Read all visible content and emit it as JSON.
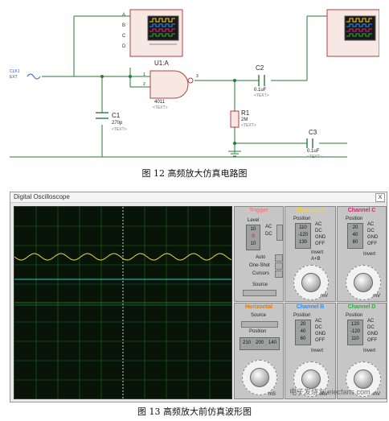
{
  "schematic": {
    "gate_label": "U1:A",
    "gate_part": "4011",
    "text_tag": "<TEXT>",
    "c1_name": "C1",
    "c1_value": "270p",
    "c2_name": "C2",
    "c2_value": "0.1uF",
    "c3_name": "C3",
    "c3_value": "0.1uF",
    "r1_name": "R1",
    "r1_value": "2M",
    "source_label": "CLK1",
    "source_sub": "EXT",
    "gate_in_a": "1",
    "gate_in_b": "2",
    "gate_out": "3",
    "scope_channels": [
      "A",
      "B",
      "C",
      "D"
    ]
  },
  "caption_top": "图 12   高频放大仿真电路图",
  "oscilloscope": {
    "window_title": "Digital Oscilloscope",
    "close_label": "X",
    "trigger": {
      "title": "Trigger",
      "level_label": "Level",
      "level_values": [
        "10",
        "0",
        "10"
      ],
      "ac_label": "AC",
      "dc_label": "DC",
      "auto_label": "Auto",
      "oneshot_label": "One-Shot",
      "cursors_label": "Cursors",
      "source_label": "Source"
    },
    "channels": [
      {
        "id": "a",
        "title": "Channel A",
        "color": "#ffd21f",
        "position_label": "Position",
        "values": [
          "110",
          "-120",
          "130"
        ],
        "options": [
          "AC",
          "DC",
          "GND",
          "OFF"
        ],
        "invert": "Invert",
        "extra": "A+B",
        "unit": "mV"
      },
      {
        "id": "b",
        "title": "Channel B",
        "color": "#2b8cff",
        "position_label": "Position",
        "values": [
          "20",
          "40",
          "60"
        ],
        "options": [
          "AC",
          "DC",
          "GND",
          "OFF"
        ],
        "invert": "Invert",
        "extra": "",
        "unit": "mV"
      },
      {
        "id": "c",
        "title": "Channel C",
        "color": "#e0207a",
        "position_label": "Position",
        "values": [
          "20",
          "40",
          "60"
        ],
        "options": [
          "AC",
          "DC",
          "GND",
          "OFF"
        ],
        "invert": "Invert",
        "extra": "",
        "unit": "mV"
      },
      {
        "id": "d",
        "title": "Channel D",
        "color": "#27b13a",
        "position_label": "Position",
        "values": [
          "120",
          "-120",
          "110"
        ],
        "options": [
          "AC",
          "DC",
          "GND",
          "OFF"
        ],
        "invert": "Invert",
        "extra": "",
        "unit": "mV"
      }
    ],
    "horizontal": {
      "title": "Horizontal",
      "source_label": "Source",
      "position_label": "Position",
      "position_values": [
        "210",
        "200",
        "140"
      ],
      "unit": "mS"
    },
    "colors": {
      "trace_yellow": "#e8e23a",
      "trace_cyan": "#33cccc",
      "trigger_title": "#ff7a7a",
      "horizontal_title": "#e07a00"
    }
  },
  "caption_bottom": "图 13   高频放大前仿真波形图",
  "watermark": "电子发烧友 elecfans.com"
}
